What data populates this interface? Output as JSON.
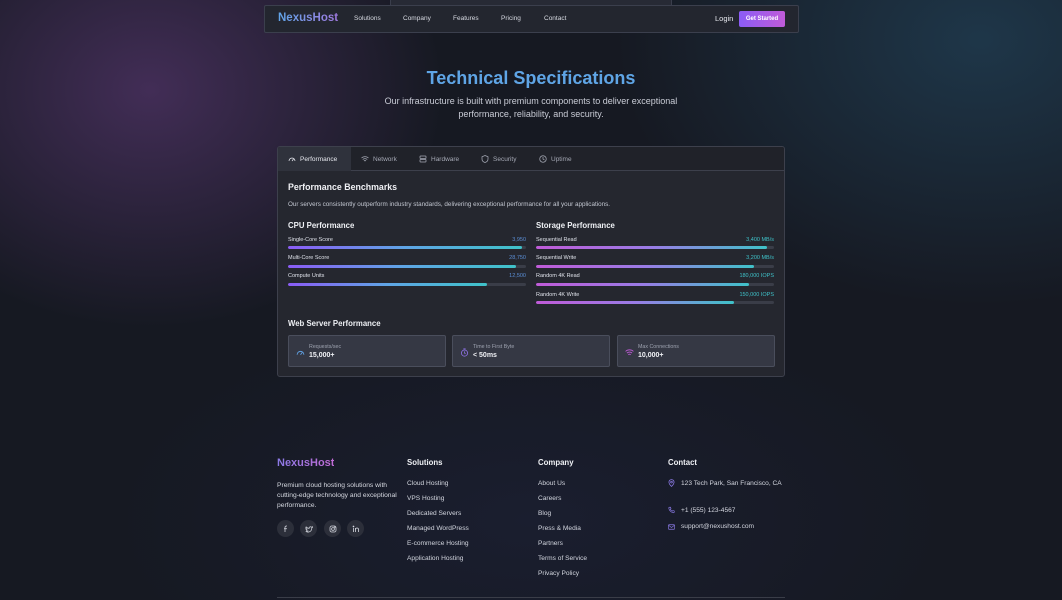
{
  "nav": {
    "brand": "NexusHost",
    "links": [
      "Solutions",
      "Company",
      "Features",
      "Pricing",
      "Contact"
    ],
    "login": "Login",
    "cta": "Get Started"
  },
  "hero": {
    "title": "Technical Specifications",
    "subtitle": "Our infrastructure is built with premium components to deliver exceptional performance, reliability, and security."
  },
  "tabs": [
    {
      "label": "Performance",
      "icon": "gauge-icon",
      "active": true
    },
    {
      "label": "Network",
      "icon": "wifi-icon"
    },
    {
      "label": "Hardware",
      "icon": "server-icon"
    },
    {
      "label": "Security",
      "icon": "shield-icon"
    },
    {
      "label": "Uptime",
      "icon": "clock-icon"
    }
  ],
  "benchmarks": {
    "title": "Performance Benchmarks",
    "description": "Our servers consistently outperform industry standards, delivering exceptional performance for all your applications.",
    "cpu": {
      "title": "CPU Performance",
      "metrics": [
        {
          "label": "Single-Core Score",
          "value": "3,950",
          "fill": 0.985
        },
        {
          "label": "Multi-Core Score",
          "value": "28,750",
          "fill": 0.96
        },
        {
          "label": "Compute Units",
          "value": "12,500",
          "fill": 0.835
        }
      ]
    },
    "storage": {
      "title": "Storage Performance",
      "metrics": [
        {
          "label": "Sequential Read",
          "value": "3,400 MB/s",
          "fill": 0.97
        },
        {
          "label": "Sequential Write",
          "value": "3,200 MB/s",
          "fill": 0.915
        },
        {
          "label": "Random 4K Read",
          "value": "180,000 IOPS",
          "fill": 0.895
        },
        {
          "label": "Random 4K Write",
          "value": "150,000 IOPS",
          "fill": 0.83
        }
      ]
    },
    "web": {
      "title": "Web Server Performance",
      "cards": [
        {
          "label": "Requests/sec",
          "value": "15,000+",
          "icon": "gauge-icon"
        },
        {
          "label": "Time to First Byte",
          "value": "< 50ms",
          "icon": "timer-icon"
        },
        {
          "label": "Max Connections",
          "value": "10,000+",
          "icon": "wifi-icon"
        }
      ]
    }
  },
  "footer": {
    "brand": "NexusHost",
    "description": "Premium cloud hosting solutions with cutting-edge technology and exceptional performance.",
    "social": [
      "facebook-icon",
      "twitter-icon",
      "instagram-icon",
      "linkedin-icon"
    ],
    "solutions": {
      "title": "Solutions",
      "links": [
        "Cloud Hosting",
        "VPS Hosting",
        "Dedicated Servers",
        "Managed WordPress",
        "E-commerce Hosting",
        "Application Hosting"
      ]
    },
    "company": {
      "title": "Company",
      "links": [
        "About Us",
        "Careers",
        "Blog",
        "Press & Media",
        "Partners",
        "Terms of Service",
        "Privacy Policy"
      ]
    },
    "contact": {
      "title": "Contact",
      "address": "123 Tech Park, San Francisco, CA",
      "phone": "+1 (555) 123-4567",
      "email": "support@nexushost.com"
    }
  },
  "colors": {
    "accent_blue": "#5fa5e6",
    "accent_purple": "#8b5cf6",
    "accent_pink": "#c05bd8",
    "cpu_value": "#5b8fd6",
    "storage_value": "#3fc2c9"
  }
}
